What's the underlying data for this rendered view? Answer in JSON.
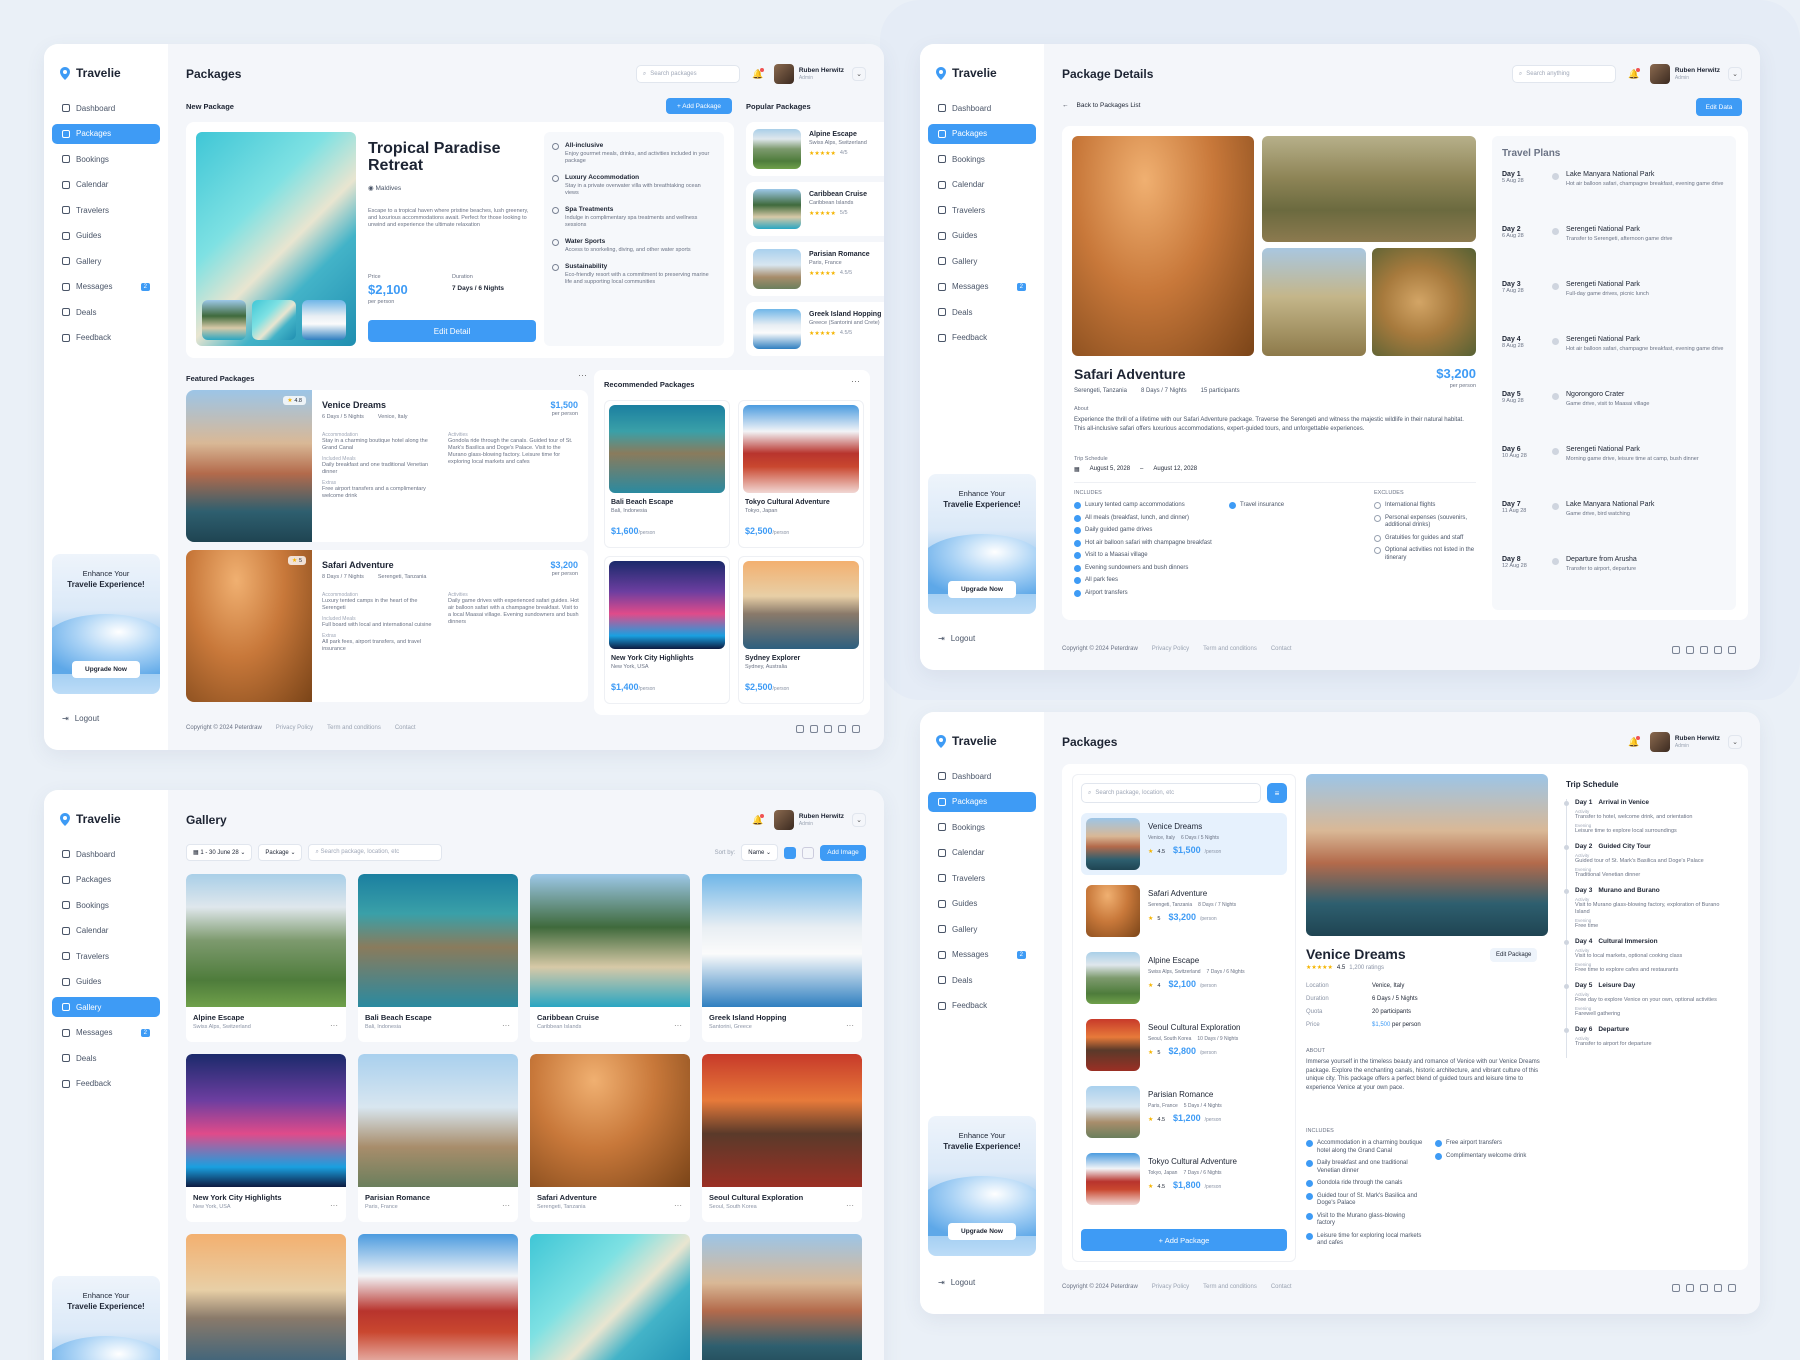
{
  "brand": "Travelie",
  "user": {
    "name": "Ruben Herwitz",
    "role": "Admin"
  },
  "nav": [
    "Dashboard",
    "Packages",
    "Bookings",
    "Calendar",
    "Travelers",
    "Guides",
    "Gallery",
    "Messages",
    "Deals",
    "Feedback"
  ],
  "messages_badge": "2",
  "promo": {
    "line1": "Enhance Your",
    "line2": "Travelie Experience!",
    "button": "Upgrade Now"
  },
  "logout": "Logout",
  "footer": {
    "copy": "Copyright © 2024 Peterdraw",
    "privacy": "Privacy Policy",
    "terms": "Term and conditions",
    "contact": "Contact"
  },
  "s1": {
    "title": "Packages",
    "search": "Search packages",
    "new_pkg": "New Package",
    "add": "+ Add Package",
    "hero": {
      "title": "Tropical Paradise Retreat",
      "loc": "Maldives",
      "desc": "Escape to a tropical haven where pristine beaches, lush greenery, and luxurious accommodations await. Perfect for those looking to unwind and experience the ultimate relaxation",
      "price_label": "Price",
      "price": "$2,100",
      "per": "per person",
      "dur_label": "Duration",
      "dur": "7 Days / 6 Nights",
      "btn": "Edit Detail"
    },
    "features": [
      {
        "t": "All-inclusive",
        "d": "Enjoy gourmet meals, drinks, and activities included in your package"
      },
      {
        "t": "Luxury Accommodation",
        "d": "Stay in a private overwater villa with breathtaking ocean views"
      },
      {
        "t": "Spa Treatments",
        "d": "Indulge in complimentary spa treatments and wellness sessions"
      },
      {
        "t": "Water Sports",
        "d": "Access to snorkeling, diving, and other water sports"
      },
      {
        "t": "Sustainability",
        "d": "Eco-friendly resort with a commitment to preserving marine life and supporting local communities"
      }
    ],
    "popular_title": "Popular Packages",
    "popular": [
      {
        "n": "Alpine Escape",
        "l": "Swiss Alps, Switzerland",
        "r": "4/5"
      },
      {
        "n": "Caribbean Cruise",
        "l": "Caribbean Islands",
        "r": "5/5"
      },
      {
        "n": "Parisian Romance",
        "l": "Paris, France",
        "r": "4.5/5"
      },
      {
        "n": "Greek Island Hopping",
        "l": "Greece (Santorini and Crete)",
        "r": "4.5/5"
      }
    ],
    "featured_title": "Featured Packages",
    "featured": [
      {
        "n": "Venice Dreams",
        "p": "$1,500",
        "per": "per person",
        "d": "6 Days / 5 Nights",
        "l": "Venice, Italy",
        "r": "4.8",
        "acc": "Stay in a charming boutique hotel along the Grand Canal",
        "inc": "Daily breakfast and one traditional Venetian dinner",
        "ext": "Free airport transfers and a complimentary welcome drink",
        "act": "Gondola ride through the canals. Guided tour of St. Mark's Basilica and Doge's Palace. Visit to the Murano glass-blowing factory. Leisure time for exploring local markets and cafes"
      },
      {
        "n": "Safari Adventure",
        "p": "$3,200",
        "per": "per person",
        "d": "8 Days / 7 Nights",
        "l": "Serengeti, Tanzania",
        "r": "5",
        "acc": "Luxury tented camps in the heart of the Serengeti",
        "inc": "Full board with local and international cuisine",
        "ext": "All park fees, airport transfers, and travel insurance",
        "act": "Daily game drives with experienced safari guides. Hot air balloon safari with a champagne breakfast. Visit to a local Maasai village. Evening sundowners and bush dinners"
      }
    ],
    "labels": {
      "acc": "Accommodation",
      "inc": "Included Meals",
      "ext": "Extras",
      "act": "Activities"
    },
    "recommended_title": "Recommended Packages",
    "recommended": [
      {
        "n": "Bali Beach Escape",
        "l": "Bali, Indonesia",
        "p": "$1,600"
      },
      {
        "n": "Tokyo Cultural Adventure",
        "l": "Tokyo, Japan",
        "p": "$2,500"
      },
      {
        "n": "New York City Highlights",
        "l": "New York, USA",
        "p": "$1,400"
      },
      {
        "n": "Sydney Explorer",
        "l": "Sydney, Australia",
        "p": "$2,500"
      }
    ],
    "per": "/person"
  },
  "s2": {
    "title": "Package Details",
    "search": "Search anything",
    "back": "Back to Packages List",
    "edit": "Edit Data",
    "name": "Safari Adventure",
    "loc": "Serengeti, Tanzania",
    "dur": "8 Days / 7 Nights",
    "people": "15 participants",
    "price": "$3,200",
    "per": "per person",
    "about_label": "About",
    "about": "Experience the thrill of a lifetime with our Safari Adventure package. Traverse the Serengeti and witness the majestic wildlife in their natural habitat. This all-inclusive safari offers luxurious accommodations, expert-guided tours, and unforgettable experiences.",
    "sched_label": "Trip Schedule",
    "start": "August 5, 2028",
    "end": "August 12, 2028",
    "inc_label": "INCLUDES",
    "exc_label": "EXCLUDES",
    "includes": [
      "Luxury tented camp accommodations",
      "All meals (breakfast, lunch, and dinner)",
      "Daily guided game drives",
      "Hot air balloon safari with champagne breakfast",
      "Visit to a Maasai village",
      "Evening sundowners and bush dinners",
      "All park fees",
      "Airport transfers",
      "Travel insurance"
    ],
    "excludes": [
      "International flights",
      "Personal expenses (souvenirs, additional drinks)",
      "Gratuities for guides and staff",
      "Optional activities not listed in the itinerary"
    ],
    "plans_title": "Travel Plans",
    "plans": [
      {
        "d": "Day 1",
        "dt": "5 Aug 28",
        "t": "Lake Manyara National Park",
        "s": "Hot air balloon safari, champagne breakfast, evening game drive"
      },
      {
        "d": "Day 2",
        "dt": "6 Aug 28",
        "t": "Serengeti National Park",
        "s": "Transfer to Serengeti, afternoon game drive"
      },
      {
        "d": "Day 3",
        "dt": "7 Aug 28",
        "t": "Serengeti National Park",
        "s": "Full-day game drives, picnic lunch"
      },
      {
        "d": "Day 4",
        "dt": "8 Aug 28",
        "t": "Serengeti National Park",
        "s": "Hot air balloon safari, champagne breakfast, evening game drive"
      },
      {
        "d": "Day 5",
        "dt": "9 Aug 28",
        "t": "Ngorongoro Crater",
        "s": "Game drive, visit to Maasai village"
      },
      {
        "d": "Day 6",
        "dt": "10 Aug 28",
        "t": "Serengeti National Park",
        "s": "Morning game drive, leisure time at camp, bush dinner"
      },
      {
        "d": "Day 7",
        "dt": "11 Aug 28",
        "t": "Lake Manyara National Park",
        "s": "Game drive, bird watching"
      },
      {
        "d": "Day 8",
        "dt": "12 Aug 28",
        "t": "Departure from Arusha",
        "s": "Transfer to airport, departure"
      }
    ]
  },
  "s3": {
    "title": "Gallery",
    "date": "1 - 30 June 28",
    "filter": "Package",
    "search": "Search package, location, etc",
    "sortby": "Sort by:",
    "sort": "Name",
    "add": "Add Image",
    "items": [
      {
        "n": "Alpine Escape",
        "l": "Swiss Alps, Switzerland"
      },
      {
        "n": "Bali Beach Escape",
        "l": "Bali, Indonesia"
      },
      {
        "n": "Caribbean Cruise",
        "l": "Caribbean Islands"
      },
      {
        "n": "Greek Island Hopping",
        "l": "Santorini, Greece"
      },
      {
        "n": "New York City Highlights",
        "l": "New York, USA"
      },
      {
        "n": "Parisian Romance",
        "l": "Paris, France"
      },
      {
        "n": "Safari Adventure",
        "l": "Serengeti, Tanzania"
      },
      {
        "n": "Seoul Cultural Exploration",
        "l": "Seoul, South Korea"
      }
    ]
  },
  "s4": {
    "title": "Packages",
    "search": "Search package, location, etc",
    "list": [
      {
        "n": "Venice Dreams",
        "l": "Venice, Italy",
        "d": "6 Days / 5 Nights",
        "r": "4.5",
        "p": "$1,500"
      },
      {
        "n": "Safari Adventure",
        "l": "Serengeti, Tanzania",
        "d": "8 Days / 7 Nights",
        "r": "5",
        "p": "$3,200"
      },
      {
        "n": "Alpine Escape",
        "l": "Swiss Alps, Switzerland",
        "d": "7 Days / 6 Nights",
        "r": "4",
        "p": "$2,100"
      },
      {
        "n": "Seoul Cultural Exploration",
        "l": "Seoul, South Korea",
        "d": "10 Days / 9 Nights",
        "r": "5",
        "p": "$2,800"
      },
      {
        "n": "Parisian Romance",
        "l": "Paris, France",
        "d": "5 Days / 4 Nights",
        "r": "4.5",
        "p": "$1,200"
      },
      {
        "n": "Tokyo Cultural Adventure",
        "l": "Tokyo, Japan",
        "d": "7 Days / 6 Nights",
        "r": "4.5",
        "p": "$1,800"
      }
    ],
    "per": "/person",
    "add": "+ Add Package",
    "detail": {
      "name": "Venice Dreams",
      "edit": "Edit Package",
      "rating": "4.5",
      "ratings": "1,200 ratings",
      "loc_l": "Location",
      "loc": "Venice, Italy",
      "dur_l": "Duration",
      "dur": "6 Days / 5 Nights",
      "quota_l": "Quota",
      "quota": "20 participants",
      "price_l": "Price",
      "price": "$1,500",
      "per": "per person",
      "about_l": "ABOUT",
      "about": "Immerse yourself in the timeless beauty and romance of Venice with our Venice Dreams package. Explore the enchanting canals, historic architecture, and vibrant culture of this unique city. This package offers a perfect blend of guided tours and leisure time to experience Venice at your own pace.",
      "inc_l": "INCLUDES",
      "includes": [
        "Accommodation in a charming boutique hotel along the Grand Canal",
        "Daily breakfast and one traditional Venetian dinner",
        "Gondola ride through the canals",
        "Guided tour of St. Mark's Basilica and Doge's Palace",
        "Visit to the Murano glass-blowing factory",
        "Leisure time for exploring local markets and cafes",
        "Free airport transfers",
        "Complimentary welcome drink"
      ]
    },
    "sched_title": "Trip Schedule",
    "sched": [
      {
        "d": "Day 1",
        "t": "Arrival in Venice",
        "a": "Transfer to hotel, welcome drink, and orientation",
        "e": "Leisure time to explore local surroundings"
      },
      {
        "d": "Day 2",
        "t": "Guided City Tour",
        "a": "Guided tour of St. Mark's Basilica and Doge's Palace",
        "e": "Traditional Venetian dinner"
      },
      {
        "d": "Day 3",
        "t": "Murano and Burano",
        "a": "Visit to Murano glass-blowing factory, exploration of Burano Island",
        "e": "Free time"
      },
      {
        "d": "Day 4",
        "t": "Cultural Immersion",
        "a": "Visit to local markets, optional cooking class",
        "e": "Free time to explore cafes and restaurants"
      },
      {
        "d": "Day 5",
        "t": "Leisure Day",
        "a": "Free day to explore Venice on your own, optional activities",
        "e": "Farewell gathering"
      },
      {
        "d": "Day 6",
        "t": "Departure",
        "a": "Transfer to airport for departure",
        "e": ""
      }
    ],
    "activity": "Activity",
    "evening": "Evening"
  }
}
